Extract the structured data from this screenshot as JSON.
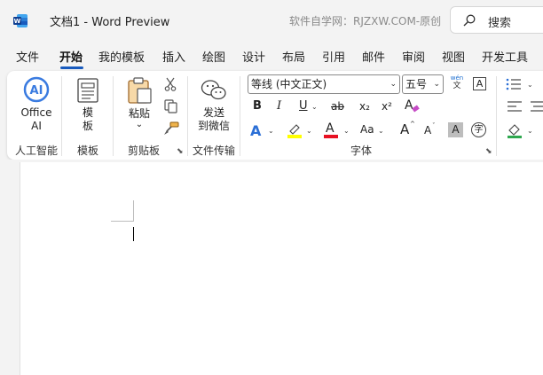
{
  "titlebar": {
    "app_icon": "word-icon",
    "title": "文档1  -  Word Preview",
    "watermark": "软件自学网：RJZXW.COM-原创",
    "search_label": "搜索",
    "search_icon": "search-icon"
  },
  "menu": {
    "items": [
      "文件",
      "开始",
      "我的模板",
      "插入",
      "绘图",
      "设计",
      "布局",
      "引用",
      "邮件",
      "审阅",
      "视图",
      "开发工具"
    ],
    "active": "开始",
    "accent_color": "#185abd"
  },
  "ribbon": {
    "ai_group": {
      "button_line1": "Office",
      "button_line2": "AI",
      "label": "人工智能"
    },
    "template_group": {
      "button_line1": "模",
      "button_line2": "板",
      "label": "模板"
    },
    "clipboard_group": {
      "paste_label": "粘贴",
      "paste_arrow": "⌄",
      "label": "剪贴板"
    },
    "transfer_group": {
      "button_line1": "发送",
      "button_line2": "到微信",
      "label": "文件传输"
    },
    "font_group": {
      "font_name": "等线 (中文正文)",
      "font_size": "五号",
      "phonetic_top": "wén",
      "phonetic_bottom": "文",
      "bold": "B",
      "italic": "I",
      "underline": "U",
      "strikethrough": "ab",
      "subscript": "x₂",
      "superscript": "x²",
      "text_effects": "A",
      "highlight_color": "#ffff00",
      "font_color_letter": "A",
      "font_color": "#e81123",
      "change_case": "Aa",
      "grow": "A",
      "shrink": "A",
      "shading": "A",
      "enclose": "字",
      "char_border": "A",
      "label": "字体"
    }
  },
  "document": {
    "page_color": "#ffffff"
  }
}
